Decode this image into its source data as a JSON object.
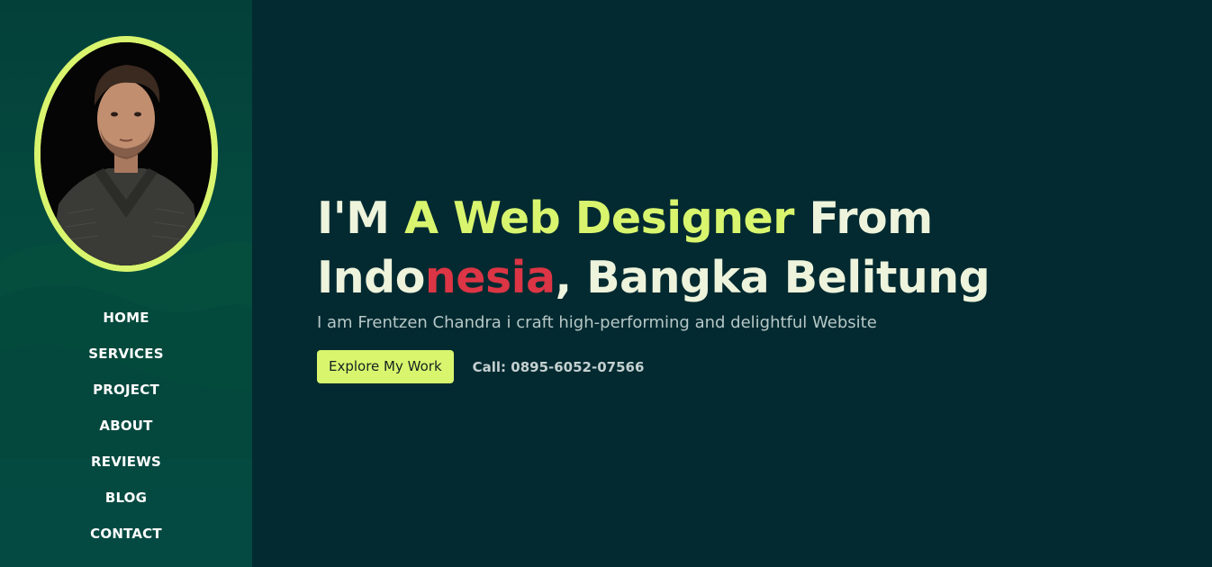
{
  "sidebar": {
    "avatar_alt": "Profile photo",
    "nav": [
      {
        "label": "HOME"
      },
      {
        "label": "SERVICES"
      },
      {
        "label": "PROJECT"
      },
      {
        "label": "ABOUT"
      },
      {
        "label": "REVIEWS"
      },
      {
        "label": "BLOG"
      },
      {
        "label": "CONTACT"
      }
    ]
  },
  "hero": {
    "headline": {
      "part1": "I'M ",
      "part2": "A Web Designer",
      "part3": " From",
      "part4": "Indo",
      "part5": "nesia",
      "part6": ", Bangka Belitung"
    },
    "subtitle": "I am Frentzen Chandra i craft high-performing and delightful Website",
    "cta_label": "Explore My Work",
    "call_text": "Call: 0895-6052-07566"
  },
  "colors": {
    "background": "#022a30",
    "sidebar": "#044b3f",
    "accent": "#d9f56e",
    "highlight": "#dc3545",
    "text": "#eef3dc"
  }
}
